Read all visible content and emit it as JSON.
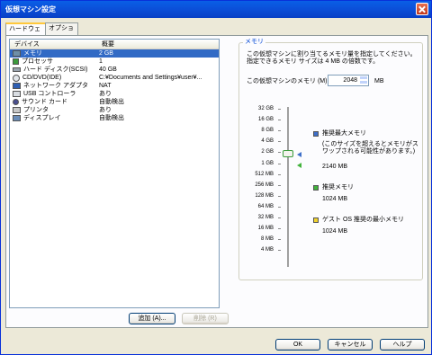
{
  "window": {
    "title": "仮想マシン設定"
  },
  "tabs": [
    {
      "label": "ハードウェア",
      "active": true
    },
    {
      "label": "オプション",
      "active": false
    }
  ],
  "device_list": {
    "headers": {
      "device": "デバイス",
      "summary": "概要"
    },
    "rows": [
      {
        "device": "メモリ",
        "summary": "2 GB",
        "icon": "memory-icon",
        "selected": true
      },
      {
        "device": "プロセッサ",
        "summary": "1",
        "icon": "processor-icon"
      },
      {
        "device": "ハード ディスク(SCSI)",
        "summary": "40 GB",
        "icon": "hard-disk-icon"
      },
      {
        "device": "CD/DVD(IDE)",
        "summary": "C:¥Documents and Settings¥user¥...",
        "icon": "cd-dvd-icon"
      },
      {
        "device": "ネットワーク アダプタ",
        "summary": "NAT",
        "icon": "network-adapter-icon"
      },
      {
        "device": "USB コントローラ",
        "summary": "あり",
        "icon": "usb-icon"
      },
      {
        "device": "サウンド カード",
        "summary": "自動検出",
        "icon": "sound-card-icon"
      },
      {
        "device": "プリンタ",
        "summary": "あり",
        "icon": "printer-icon"
      },
      {
        "device": "ディスプレイ",
        "summary": "自動検出",
        "icon": "display-icon"
      }
    ]
  },
  "buttons": {
    "add": "追加 (A)...",
    "remove": "削除 (R)",
    "ok": "OK",
    "cancel": "キャンセル",
    "help": "ヘルプ"
  },
  "memory": {
    "group_label": "メモリ",
    "description": "この仮想マシンに割り当てるメモリ量を指定してください。指定できるメモリ サイズは 4 MB の倍数です。",
    "field_label": "この仮想マシンのメモリ (M):",
    "value": "2048",
    "unit": "MB",
    "scale_labels": [
      "32 GB",
      "16 GB",
      "8 GB",
      "4 GB",
      "2 GB",
      "1 GB",
      "512 MB",
      "256 MB",
      "128 MB",
      "64 MB",
      "32 MB",
      "16 MB",
      "8 MB",
      "4 MB"
    ],
    "legend": [
      {
        "title": "推奨最大メモリ",
        "note": "(このサイズを超えるとメモリがスワップされる可能性があります。)",
        "value": "2140 MB",
        "color": "#3E6FC9"
      },
      {
        "title": "推奨メモリ",
        "value": "1024 MB",
        "color": "#41B23B"
      },
      {
        "title": "ゲスト OS 推奨の最小メモリ",
        "value": "1024 MB",
        "color": "#F0D22E"
      }
    ]
  }
}
